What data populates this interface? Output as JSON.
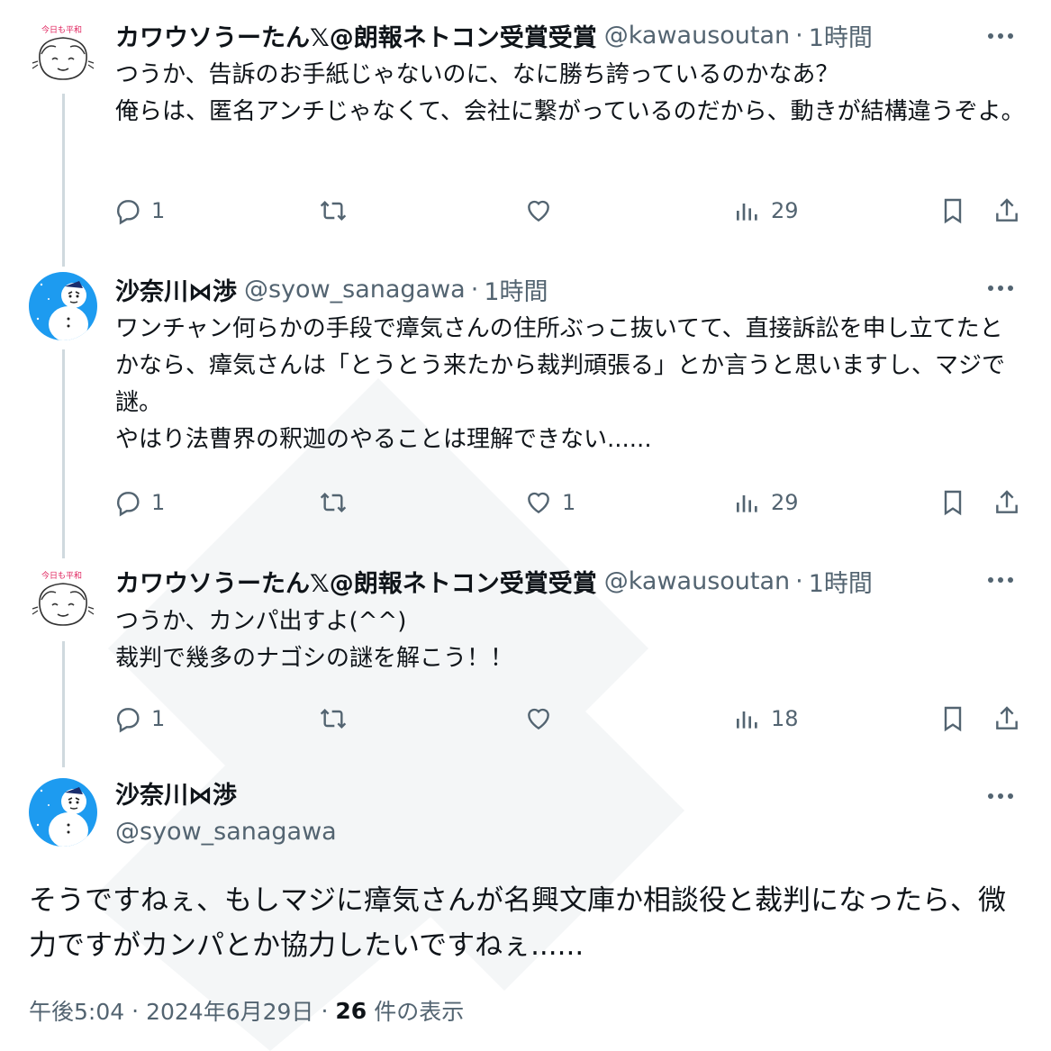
{
  "tweets": [
    {
      "name": "カワウソうーたん𝕏@朗報ネトコン受賞受賞",
      "handle": "@kawausoutan",
      "separator": "·",
      "time": "1時間",
      "lines": [
        "つうか、告訴のお手紙じゃないのに、なに勝ち誇っているのかなあ？",
        "俺らは、匿名アンチじゃなくて、会社に繋がっているのだから、動きが結構違うぞよ。"
      ],
      "replies": "1",
      "likes": "",
      "views": "29"
    },
    {
      "name": "沙奈川⋈渉",
      "handle": "@syow_sanagawa",
      "separator": "·",
      "time": "1時間",
      "lines": [
        "ワンチャン何らかの手段で瘴気さんの住所ぶっこ抜いてて、直接訴訟を申し立てたとかなら、瘴気さんは「とうとう来たから裁判頑張る」とか言うと思いますし、マジで謎。",
        "やはり法曹界の釈迦のやることは理解できない......"
      ],
      "replies": "1",
      "likes": "1",
      "views": "29"
    },
    {
      "name": "カワウソうーたん𝕏@朗報ネトコン受賞受賞",
      "handle": "@kawausoutan",
      "separator": "·",
      "time": "1時間",
      "lines": [
        "つうか、カンパ出すよ(^^)",
        "裁判で幾多のナゴシの謎を解こう！！"
      ],
      "replies": "1",
      "likes": "",
      "views": "18"
    }
  ],
  "main_tweet": {
    "name": "沙奈川⋈渉",
    "handle": "@syow_sanagawa",
    "text_lines": [
      "そうですねぇ、もしマジに瘴気さんが名興文庫か相談役と裁判になったら、微力ですがカンパとか協力したいですねぇ......"
    ],
    "time": "午後5:04",
    "date": "2024年6月29日",
    "separator": "·",
    "views_count": "26",
    "views_label": "件の表示"
  },
  "icons": {
    "reply": "reply-icon",
    "retweet": "retweet-icon",
    "like": "like-icon",
    "views": "views-icon",
    "bookmark": "bookmark-icon",
    "share": "share-icon",
    "more": "more-icon"
  },
  "colors": {
    "text": "#0f1419",
    "secondary": "#536471",
    "thread_line": "#cfd9de",
    "avatar_blue": "#1d9bf0"
  }
}
